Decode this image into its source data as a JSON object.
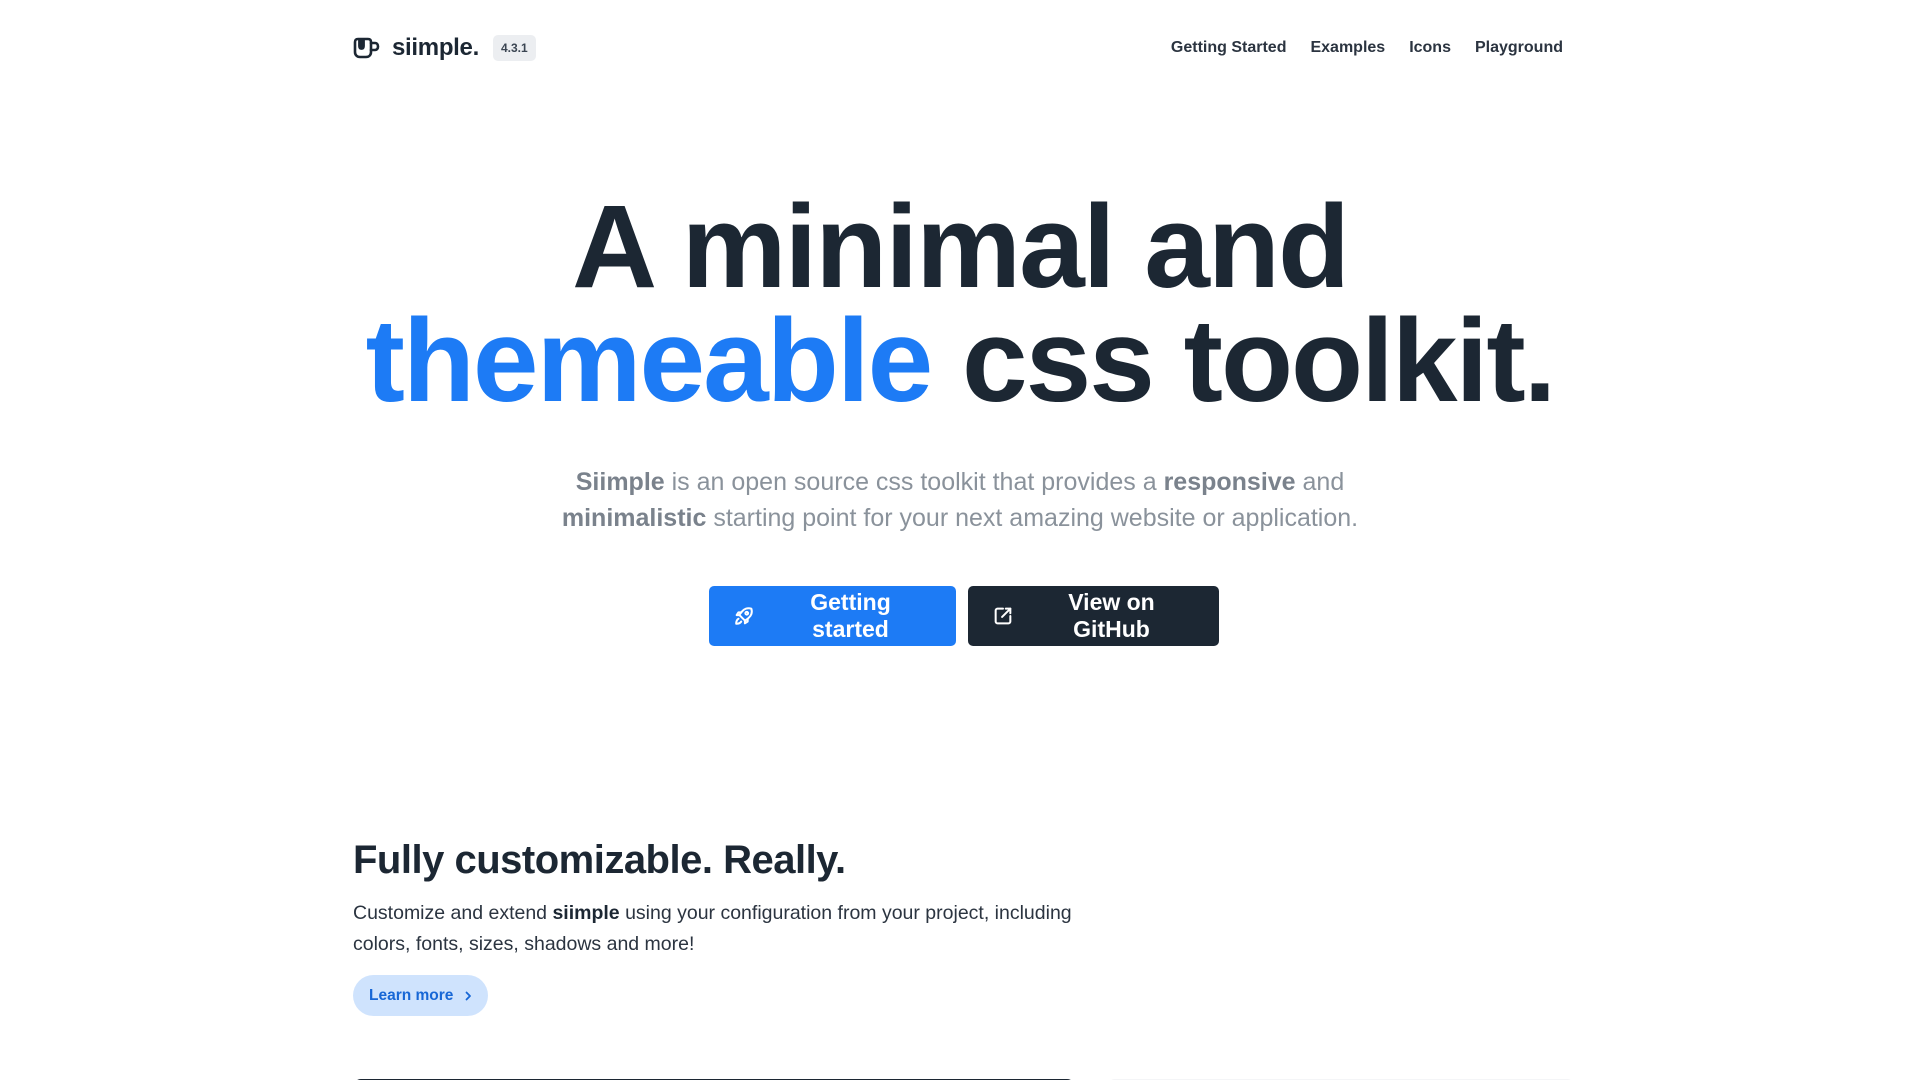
{
  "brand": {
    "name": "siimple.",
    "version": "4.3.1",
    "logo_icon": "mug-icon"
  },
  "nav": {
    "items": [
      {
        "label": "Getting Started"
      },
      {
        "label": "Examples"
      },
      {
        "label": "Icons"
      },
      {
        "label": "Playground"
      }
    ]
  },
  "hero": {
    "title_line1": "A minimal and",
    "title_accent": "themeable",
    "title_line2_rest": " css toolkit.",
    "subtitle": {
      "b1": "Siimple",
      "t1": " is an open source css toolkit that provides a ",
      "b2": "responsive",
      "t2": " and",
      "b3": "minimalistic",
      "t3": " starting point for your next amazing website or application."
    },
    "primary_button": {
      "label": "Getting started",
      "icon": "rocket-icon"
    },
    "secondary_button": {
      "label": "View on GitHub",
      "icon": "external-link-icon"
    }
  },
  "feature": {
    "title": "Fully customizable. Really.",
    "desc_t1": "Customize and extend ",
    "desc_b1": "siimple",
    "desc_t2": " using your configuration from your project, including colors, fonts, sizes, shadows and more!",
    "learn_more": {
      "label": "Learn more",
      "icon": "chevron-right-icon"
    }
  },
  "colors": {
    "accent": "#1d7bf5",
    "dark": "#1c2733",
    "muted_text": "#8a929b",
    "pill_bg": "#cfe3fd"
  }
}
